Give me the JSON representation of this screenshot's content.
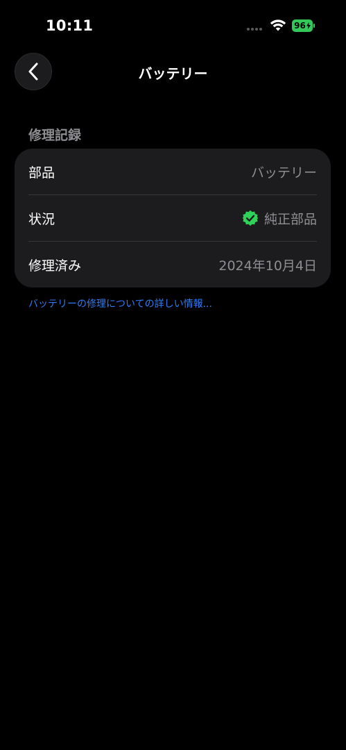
{
  "status_bar": {
    "time": "10:11",
    "battery_level": "96",
    "battery_color": "#34c759"
  },
  "nav": {
    "back_icon": "chevron-left-icon",
    "title": "バッテリー"
  },
  "section": {
    "header": "修理記録"
  },
  "rows": [
    {
      "label": "部品",
      "value": "バッテリー"
    },
    {
      "label": "状況",
      "value": "純正部品",
      "icon": "verified-check-icon",
      "icon_color": "#30d158"
    },
    {
      "label": "修理済み",
      "value": "2024年10月4日"
    }
  ],
  "footer": {
    "link_text": "バッテリーの修理についての詳しい情報...",
    "link_color": "#2f7cf6"
  }
}
